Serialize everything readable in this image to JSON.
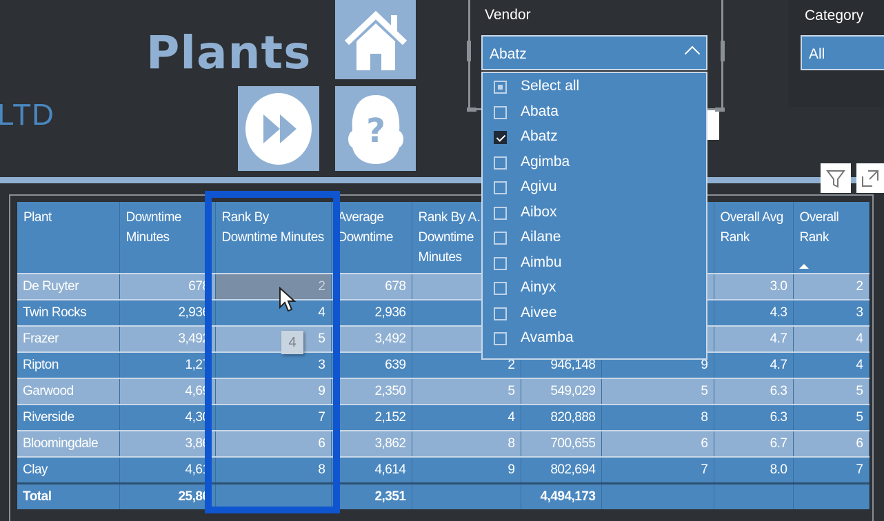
{
  "header": {
    "company_suffix": "LTD",
    "title": "Plants"
  },
  "nav": {
    "home": "home-icon",
    "next": "fast-forward-icon",
    "help": "help-icon"
  },
  "vendor_slicer": {
    "label": "Vendor",
    "selected": "Abatz",
    "options": [
      {
        "label": "Select all",
        "state": "partial"
      },
      {
        "label": "Abata",
        "state": "unchecked"
      },
      {
        "label": "Abatz",
        "state": "checked"
      },
      {
        "label": "Agimba",
        "state": "unchecked"
      },
      {
        "label": "Agivu",
        "state": "unchecked"
      },
      {
        "label": "Aibox",
        "state": "unchecked"
      },
      {
        "label": "Ailane",
        "state": "unchecked"
      },
      {
        "label": "Aimbu",
        "state": "unchecked"
      },
      {
        "label": "Ainyx",
        "state": "unchecked"
      },
      {
        "label": "Aivee",
        "state": "unchecked"
      },
      {
        "label": "Avamba",
        "state": "unchecked"
      }
    ]
  },
  "category_slicer": {
    "label": "Category",
    "selected": "All"
  },
  "tooltip": "4",
  "table": {
    "columns": [
      "Plant",
      "Downtime Minutes",
      "Rank By Downtime Minutes",
      "Average Downtime",
      "Rank By Average Downtime Minutes",
      "",
      "",
      "Overall Avg Rank",
      "Overall Rank"
    ],
    "header_display": [
      "Plant",
      "Downtime Minutes",
      "Rank By Downtime Minutes",
      "Average Downtime",
      "Rank By A… Downtime Minutes",
      "",
      "",
      "Overall Avg Rank",
      "Overall Rank"
    ],
    "sort": {
      "column": "Overall Rank",
      "direction": "ascending"
    },
    "rows": [
      [
        "De Ruyter",
        "678",
        "2",
        "678",
        "",
        "",
        "",
        "3.0",
        "2"
      ],
      [
        "Twin Rocks",
        "2,936",
        "4",
        "2,936",
        "",
        "",
        "",
        "4.3",
        "3"
      ],
      [
        "Frazer",
        "3,492",
        "5",
        "3,492",
        "",
        "",
        "",
        "4.7",
        "4"
      ],
      [
        "Ripton",
        "1,27",
        "3",
        "639",
        "2",
        "946,148",
        "9",
        "4.7",
        "4"
      ],
      [
        "Garwood",
        "4,69",
        "9",
        "2,350",
        "5",
        "549,029",
        "5",
        "6.3",
        "5"
      ],
      [
        "Riverside",
        "4,30",
        "7",
        "2,152",
        "4",
        "820,888",
        "8",
        "6.3",
        "5"
      ],
      [
        "Bloomingdale",
        "3,86",
        "6",
        "3,862",
        "8",
        "700,655",
        "6",
        "6.7",
        "6"
      ],
      [
        "Clay",
        "4,61",
        "8",
        "4,614",
        "9",
        "802,694",
        "7",
        "8.0",
        "7"
      ]
    ],
    "total": [
      "Total",
      "25,86",
      "",
      "2,351",
      "",
      "4,494,173",
      "",
      "",
      ""
    ]
  },
  "colors": {
    "background": "#2d3034",
    "accent": "#4a87bf",
    "light": "#8fb0d2",
    "highlight": "#0f55d0"
  }
}
